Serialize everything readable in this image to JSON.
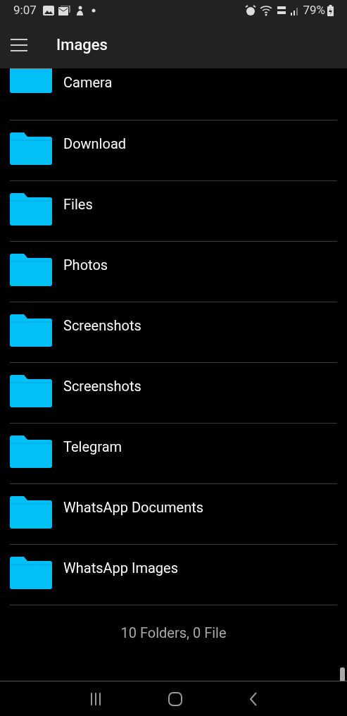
{
  "status_bar": {
    "time": "9:07",
    "battery": "79%"
  },
  "toolbar": {
    "title": "Images"
  },
  "folders": [
    {
      "name": "Camera"
    },
    {
      "name": "Download"
    },
    {
      "name": "Files"
    },
    {
      "name": "Photos"
    },
    {
      "name": "Screenshots"
    },
    {
      "name": "Screenshots"
    },
    {
      "name": "Telegram"
    },
    {
      "name": "WhatsApp Documents"
    },
    {
      "name": "WhatsApp Images"
    }
  ],
  "summary": "10 Folders, 0 File"
}
